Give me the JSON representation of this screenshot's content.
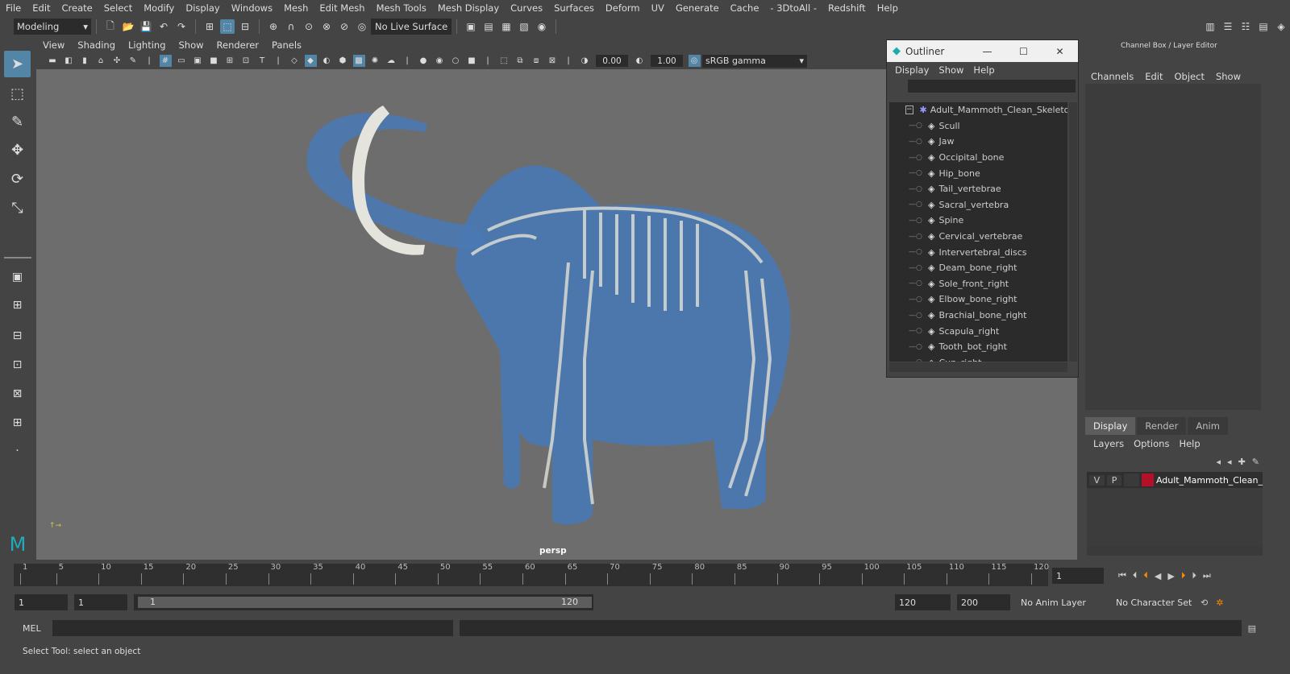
{
  "menubar": [
    "File",
    "Edit",
    "Create",
    "Select",
    "Modify",
    "Display",
    "Windows",
    "Mesh",
    "Edit Mesh",
    "Mesh Tools",
    "Mesh Display",
    "Curves",
    "Surfaces",
    "Deform",
    "UV",
    "Generate",
    "Cache",
    "- 3DtoAll -",
    "Redshift",
    "Help"
  ],
  "shelf": {
    "mode": "Modeling",
    "live_surface": "No Live Surface"
  },
  "panel_menu": [
    "View",
    "Shading",
    "Lighting",
    "Show",
    "Renderer",
    "Panels"
  ],
  "panel_tools": {
    "value1": "0.00",
    "value2": "1.00",
    "color_mgmt": "sRGB gamma"
  },
  "viewport": {
    "camera_label": "persp"
  },
  "outliner": {
    "title": "Outliner",
    "menu": [
      "Display",
      "Show",
      "Help"
    ],
    "root": "Adult_Mammoth_Clean_Skeleto",
    "items": [
      "Scull",
      "Jaw",
      "Occipital_bone",
      "Hip_bone",
      "Tail_vertebrae",
      "Sacral_vertebra",
      "Spine",
      "Cervical_vertebrae",
      "Intervertebral_discs",
      "Deam_bone_right",
      "Sole_front_right",
      "Elbow_bone_right",
      "Brachial_bone_right",
      "Scapula_right",
      "Tooth_bot_right",
      "Cun_right"
    ]
  },
  "channel_box": {
    "title": "Channel Box / Layer Editor",
    "menu": [
      "Channels",
      "Edit",
      "Object",
      "Show"
    ]
  },
  "layer_editor": {
    "tabs": [
      "Display",
      "Render",
      "Anim"
    ],
    "menu": [
      "Layers",
      "Options",
      "Help"
    ],
    "layer": {
      "v": "V",
      "p": "P",
      "name": "Adult_Mammoth_Clean_",
      "color": "#b3102a"
    }
  },
  "timeline": {
    "ticks": [
      "1",
      "5",
      "10",
      "15",
      "20",
      "25",
      "30",
      "35",
      "40",
      "45",
      "50",
      "55",
      "60",
      "65",
      "70",
      "75",
      "80",
      "85",
      "90",
      "95",
      "100",
      "105",
      "110",
      "115",
      "120"
    ],
    "current_frame": "1"
  },
  "range": {
    "start": "1",
    "start2": "1",
    "slider_start": "1",
    "slider_end": "120",
    "end": "120",
    "end2": "200",
    "anim_layer": "No Anim Layer",
    "char_set": "No Character Set"
  },
  "mel": {
    "label": "MEL"
  },
  "status": "Select Tool: select an object"
}
